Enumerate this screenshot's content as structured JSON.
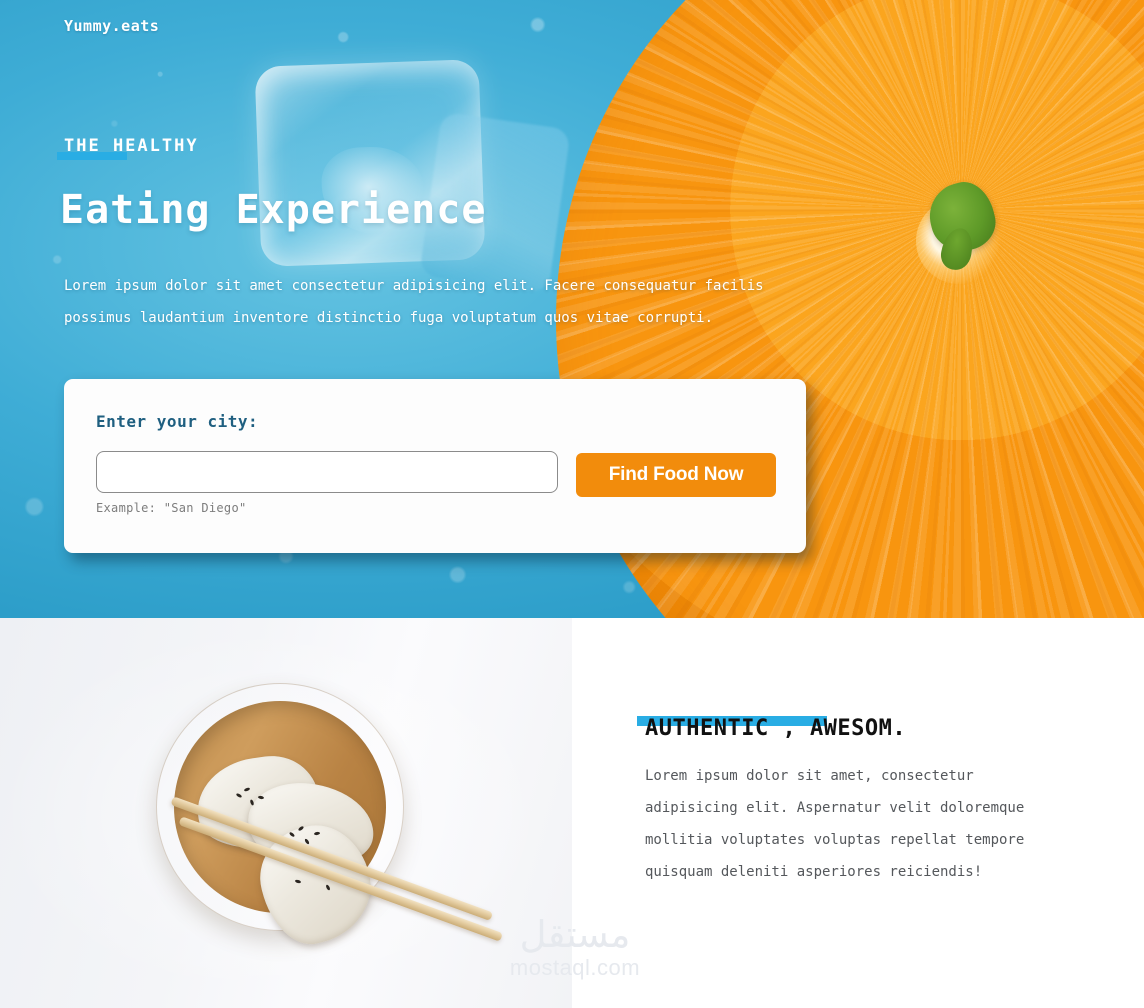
{
  "brand": {
    "logo": "Yummy.eats"
  },
  "hero": {
    "eyebrow": "THE HEALTHY",
    "title": "Eating Experience",
    "paragraph": "Lorem ipsum dolor sit amet consectetur adipisicing elit. Facere consequatur facilis possimus laudantium inventore distinctio fuga voluptatum quos vitae corrupti.",
    "accent_color": "#29ade4",
    "background_color": "#47b4da",
    "image_description": "ice-cube-and-orange-slice-photo"
  },
  "search_card": {
    "label": "Enter your city:",
    "input_value": "",
    "input_placeholder": "",
    "button_label": "Find Food Now",
    "button_color": "#f28c0c",
    "hint": "Example: \"San Diego\""
  },
  "feature": {
    "heading": "AUTHENTIC , AWESOM.",
    "paragraph": "Lorem ipsum dolor sit amet, consectetur adipisicing elit. Aspernatur velit doloremque mollitia voluptates voluptas repellat tempore quisquam deleniti asperiores reiciendis!",
    "accent_color": "#29ade4",
    "image_description": "dumplings-in-wooden-bowl-with-chopsticks"
  },
  "watermark": {
    "arabic": "مستقل",
    "latin": "mostaql.com"
  }
}
